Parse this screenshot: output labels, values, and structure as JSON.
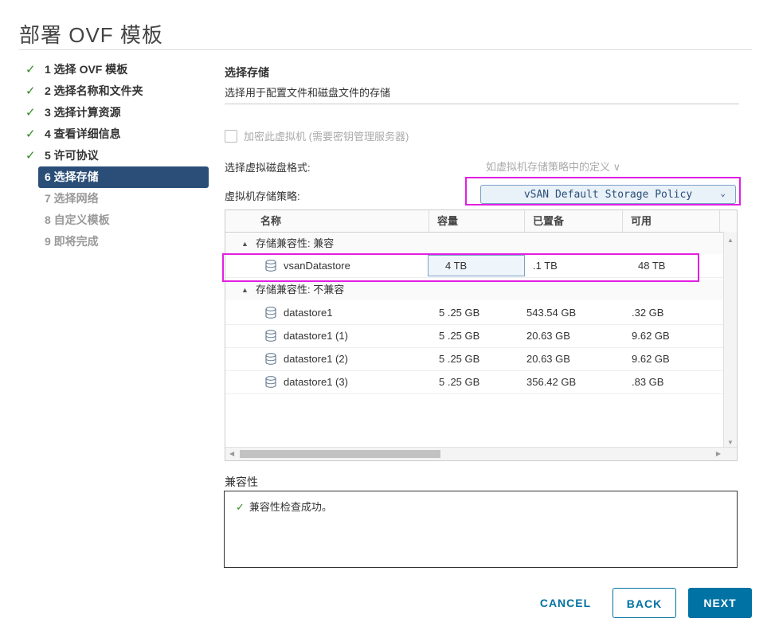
{
  "dialog": {
    "title": "部署 OVF 模板"
  },
  "steps": [
    {
      "label": "1 选择 OVF 模板",
      "state": "done"
    },
    {
      "label": "2 选择名称和文件夹",
      "state": "done"
    },
    {
      "label": "3 选择计算资源",
      "state": "done"
    },
    {
      "label": "4 查看详细信息",
      "state": "done"
    },
    {
      "label": "5 许可协议",
      "state": "done"
    },
    {
      "label": "6 选择存储",
      "state": "active"
    },
    {
      "label": "7 选择网络",
      "state": "todo"
    },
    {
      "label": "8 自定义模板",
      "state": "todo"
    },
    {
      "label": "9 即将完成",
      "state": "todo"
    }
  ],
  "storage": {
    "title": "选择存储",
    "description": "选择用于配置文件和磁盘文件的存储",
    "encrypt_label": "加密此虚拟机 (需要密钥管理服务器)",
    "disk_format_label": "选择虚拟磁盘格式:",
    "disk_format_value": "如虚拟机存储策略中的定义 ∨",
    "policy_label": "虚拟机存储策略:",
    "policy_value": "vSAN Default Storage Policy"
  },
  "grid": {
    "columns": [
      "名称",
      "容量",
      "已置备",
      "可用"
    ],
    "groups": [
      {
        "label": "存储兼容性: 兼容",
        "rows": [
          {
            "name": "vsanDatastore",
            "capacity": "4 TB",
            "provisioned": ".1 TB",
            "free": "48 TB"
          }
        ]
      },
      {
        "label": "存储兼容性: 不兼容",
        "rows": [
          {
            "name": "datastore1",
            "capacity": "5 .25 GB",
            "provisioned": "543.54 GB",
            "free": "  .32 GB"
          },
          {
            "name": "datastore1 (1)",
            "capacity": "5 .25 GB",
            "provisioned": "20.63 GB",
            "free": " 9.62 GB"
          },
          {
            "name": "datastore1 (2)",
            "capacity": "5 .25 GB",
            "provisioned": "20.63 GB",
            "free": " 9.62 GB"
          },
          {
            "name": "datastore1 (3)",
            "capacity": "5 .25 GB",
            "provisioned": "356.42 GB",
            "free": " .83 GB"
          }
        ]
      }
    ]
  },
  "compatibility": {
    "title": "兼容性",
    "message": "兼容性检查成功。"
  },
  "buttons": {
    "cancel": "CANCEL",
    "back": "BACK",
    "next": "NEXT"
  }
}
